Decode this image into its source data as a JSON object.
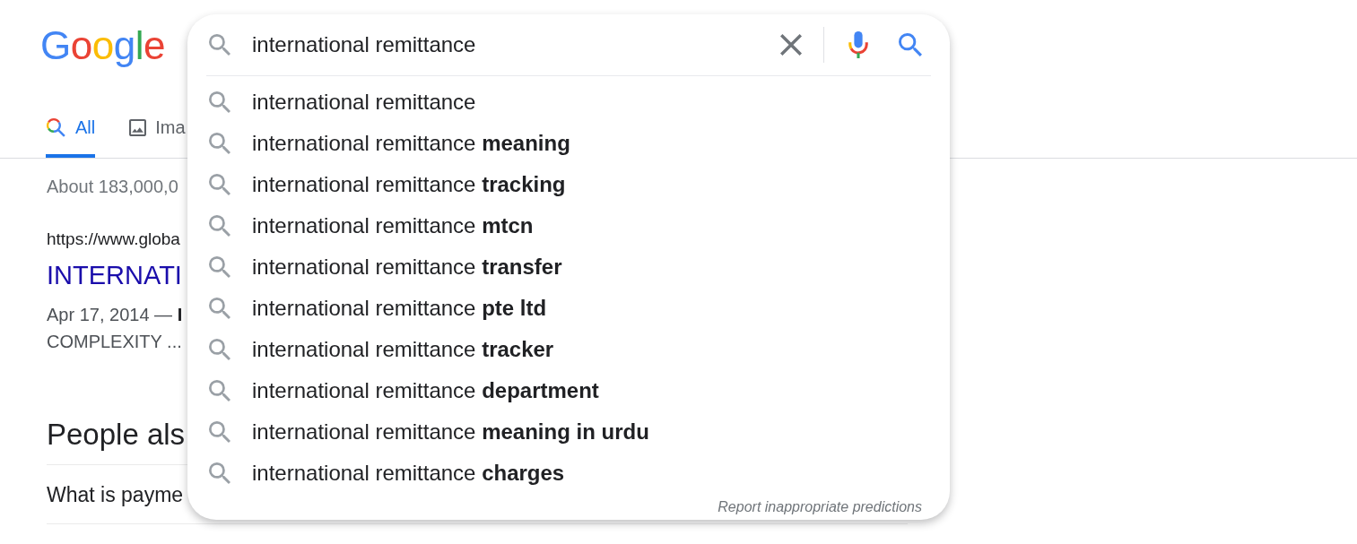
{
  "logo": "Google",
  "tabs": [
    {
      "label": "All",
      "kind": "all",
      "selected": true
    },
    {
      "label": "Ima",
      "kind": "images",
      "selected": false
    }
  ],
  "results": {
    "stats": "About 183,000,0",
    "result": {
      "url": "https://www.globa",
      "title": "INTERNATI",
      "snippet_lines": [
        "Apr 17, 2014 — **I**",
        "COMPLEXITY ..."
      ]
    }
  },
  "people_also_ask": {
    "heading": "People als",
    "questions": [
      "What is payme"
    ]
  },
  "search": {
    "value": "international remittance"
  },
  "suggestions": [
    "international remittance",
    "international remittance **meaning**",
    "international remittance **tracking**",
    "international remittance **mtcn**",
    "international remittance **transfer**",
    "international remittance **pte ltd**",
    "international remittance **tracker**",
    "international remittance **department**",
    "international remittance **meaning in urdu**",
    "international remittance **charges**"
  ],
  "report_link": "Report inappropriate predictions"
}
